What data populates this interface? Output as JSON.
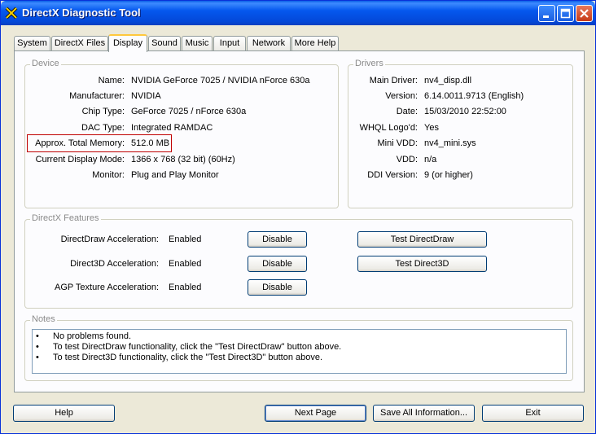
{
  "window": {
    "title": "DirectX Diagnostic Tool"
  },
  "tabs": [
    "System",
    "DirectX Files",
    "Display",
    "Sound",
    "Music",
    "Input",
    "Network",
    "More Help"
  ],
  "active_tab": "Display",
  "device": {
    "group_label": "Device",
    "rows": [
      {
        "label": "Name:",
        "value": "NVIDIA GeForce 7025 / NVIDIA nForce 630a"
      },
      {
        "label": "Manufacturer:",
        "value": "NVIDIA"
      },
      {
        "label": "Chip Type:",
        "value": "GeForce 7025 / nForce 630a"
      },
      {
        "label": "DAC Type:",
        "value": "Integrated RAMDAC"
      },
      {
        "label": "Approx. Total Memory:",
        "value": "512.0 MB"
      },
      {
        "label": "Current Display Mode:",
        "value": "1366 x 768 (32 bit) (60Hz)"
      },
      {
        "label": "Monitor:",
        "value": "Plug and Play Monitor"
      }
    ]
  },
  "drivers": {
    "group_label": "Drivers",
    "rows": [
      {
        "label": "Main Driver:",
        "value": "nv4_disp.dll"
      },
      {
        "label": "Version:",
        "value": "6.14.0011.9713 (English)"
      },
      {
        "label": "Date:",
        "value": "15/03/2010 22:52:00"
      },
      {
        "label": "WHQL Logo'd:",
        "value": "Yes"
      },
      {
        "label": "Mini VDD:",
        "value": "nv4_mini.sys"
      },
      {
        "label": "VDD:",
        "value": "n/a"
      },
      {
        "label": "DDI Version:",
        "value": "9 (or higher)"
      }
    ]
  },
  "features": {
    "group_label": "DirectX Features",
    "rows": [
      {
        "label": "DirectDraw Acceleration:",
        "value": "Enabled",
        "button": "Disable",
        "test_button": "Test DirectDraw"
      },
      {
        "label": "Direct3D Acceleration:",
        "value": "Enabled",
        "button": "Disable",
        "test_button": "Test Direct3D"
      },
      {
        "label": "AGP Texture Acceleration:",
        "value": "Enabled",
        "button": "Disable"
      }
    ]
  },
  "notes": {
    "group_label": "Notes",
    "bullet": "•",
    "lines": [
      "No problems found.",
      "To test DirectDraw functionality, click the \"Test DirectDraw\" button above.",
      "To test Direct3D functionality, click the \"Test Direct3D\" button above."
    ]
  },
  "footer": {
    "help": "Help",
    "next_page": "Next Page",
    "save_all": "Save All Information...",
    "exit": "Exit"
  },
  "colors": {
    "title_bar": "#0558ee",
    "highlight_box": "#c00000",
    "active_tab_accent": "#ffc83c"
  }
}
